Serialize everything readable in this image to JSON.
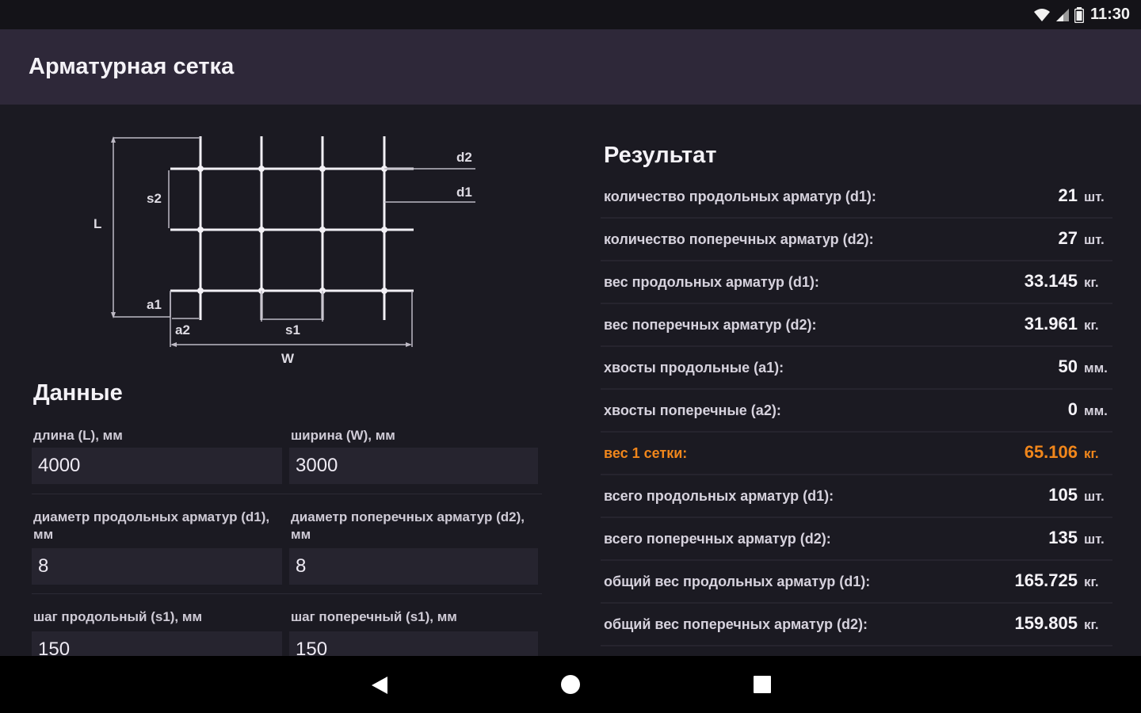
{
  "status_bar": {
    "time": "11:30"
  },
  "app_bar": {
    "title": "Арматурная сетка"
  },
  "diagram": {
    "labels": {
      "L": "L",
      "W": "W",
      "d1": "d1",
      "d2": "d2",
      "s1": "s1",
      "s2": "s2",
      "a1": "a1",
      "a2": "a2"
    }
  },
  "data_section": {
    "title": "Данные",
    "fields": [
      {
        "label": "длина (L), мм",
        "value": "4000"
      },
      {
        "label": "ширина (W), мм",
        "value": "3000"
      },
      {
        "label": "диаметр продольных арматур (d1), мм",
        "value": "8"
      },
      {
        "label": "диаметр поперечных арматур (d2), мм",
        "value": "8"
      },
      {
        "label": "шаг продольный (s1), мм",
        "value": "150"
      },
      {
        "label": "шаг поперечный (s1), мм",
        "value": "150"
      }
    ]
  },
  "result_section": {
    "title": "Результат",
    "rows": [
      {
        "label": "количество продольных арматур (d1):",
        "value": "21",
        "unit": "шт."
      },
      {
        "label": "количество поперечных арматур (d2):",
        "value": "27",
        "unit": "шт."
      },
      {
        "label": "вес продольных арматур (d1):",
        "value": "33.145",
        "unit": "кг."
      },
      {
        "label": "вес поперечных арматур (d2):",
        "value": "31.961",
        "unit": "кг."
      },
      {
        "label": "хвосты продольные (a1):",
        "value": "50",
        "unit": "мм."
      },
      {
        "label": "хвосты поперечные (a2):",
        "value": "0",
        "unit": "мм."
      },
      {
        "label": "вес 1 сетки:",
        "value": "65.106",
        "unit": "кг.",
        "highlight": true
      },
      {
        "label": "всего продольных арматур (d1):",
        "value": "105",
        "unit": "шт."
      },
      {
        "label": "всего поперечных арматур (d2):",
        "value": "135",
        "unit": "шт."
      },
      {
        "label": "общий вес продольных арматур (d1):",
        "value": "165.725",
        "unit": "кг."
      },
      {
        "label": "общий вес поперечных арматур (d2):",
        "value": "159.805",
        "unit": "кг."
      }
    ]
  },
  "colors": {
    "accent": "#f0861b",
    "app_bar": "#2e2839",
    "background": "#1b1a22"
  },
  "nav_icons": [
    "back-icon",
    "home-icon",
    "recents-icon"
  ]
}
